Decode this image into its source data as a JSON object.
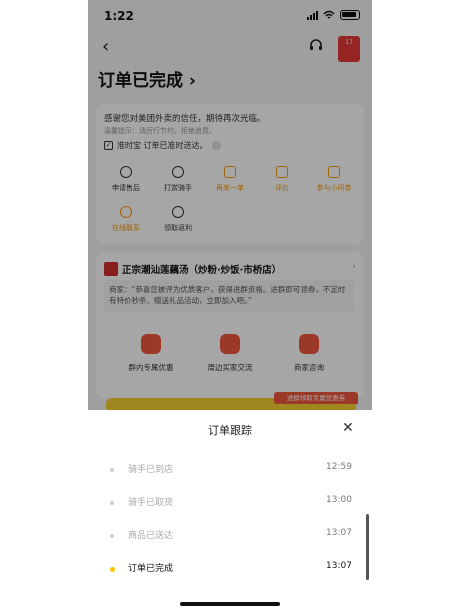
{
  "status_bar": {
    "time": "1:22"
  },
  "header": {
    "title": "订单已完成 ›",
    "badge_text": "17"
  },
  "card_main": {
    "thanks": "感谢您对美团外卖的信任，期待再次光临。",
    "tip": "温馨提示：请厉行节约，拒绝浪费。",
    "ontime": "准时宝  订单已准时送达。",
    "actions": [
      {
        "label": "申请售后",
        "orange": false
      },
      {
        "label": "打赏骑手",
        "orange": false
      },
      {
        "label": "再来一单",
        "orange": true
      },
      {
        "label": "评价",
        "orange": true
      },
      {
        "label": "参与小问卷",
        "orange": true
      },
      {
        "label": "在线联系",
        "orange": true
      },
      {
        "label": "领取返利",
        "orange": false
      }
    ]
  },
  "shop": {
    "name": "正宗潮汕莲藕汤（炒粉·炒饭·市桥店）",
    "message": "商家：“恭喜您被评为优质客户，获得进群资格。进群即可领券，不定时有特价秒杀、赠送礼品活动，立即加入吧。”",
    "features": [
      "群内专属优惠",
      "周边买家交流",
      "商家咨询"
    ],
    "promo": "进群领取专属优惠券"
  },
  "sheet": {
    "title": "订单跟踪",
    "tracking": [
      {
        "label": "骑手已到店",
        "time": "12:59",
        "active": false
      },
      {
        "label": "骑手已取货",
        "time": "13:00",
        "active": false
      },
      {
        "label": "商品已送达",
        "time": "13:07",
        "active": false
      },
      {
        "label": "订单已完成",
        "time": "13:07",
        "active": true
      }
    ]
  },
  "colors": {
    "accent": "#f8c300",
    "brand_red": "#f0563c",
    "orange": "#f39c12"
  }
}
